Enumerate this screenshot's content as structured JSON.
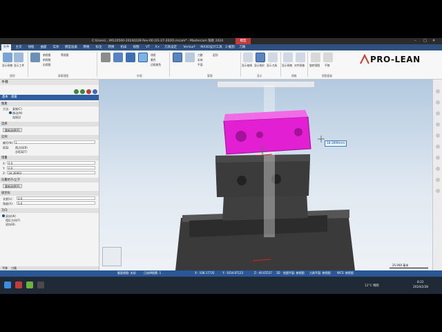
{
  "window": {
    "title": "C:\\Users\\...\\M120500-20240228 Rev-00 (01-27-2020).mcam* - Mastercam 铣削 2024",
    "context_tab": "模型"
  },
  "logo": {
    "text": "PRO-LEAN"
  },
  "ribbon_tabs": [
    "文件",
    "主页",
    "线框",
    "曲面",
    "实体",
    "模型准备",
    "网格",
    "标注",
    "转换",
    "机床",
    "视图",
    "VT",
    "X+",
    "刀具设定",
    "Verisurf",
    "MX3D设计工具",
    "2-截割",
    "刀路"
  ],
  "active_tab_index": 0,
  "ribbon_groups": [
    {
      "label": "规划",
      "buttons": [
        "显示网格",
        "显示工件"
      ]
    },
    {
      "label": "屏幕视图",
      "buttons": [
        "俯视图",
        "前视图",
        "右视图",
        "等视图"
      ]
    },
    {
      "label": "外观",
      "buttons": [
        "线框",
        "着色",
        "边框着色"
      ]
    },
    {
      "label": "管理",
      "buttons": [
        "刀路",
        "实体",
        "平面",
        "层别"
      ]
    },
    {
      "label": "显示",
      "buttons": [
        "显示轴线",
        "显示指针",
        "显示刀具"
      ]
    },
    {
      "label": "网格",
      "buttons": [
        "显示网格",
        "对齐网格"
      ]
    },
    {
      "label": "视图面板",
      "buttons": [
        "旋转视图",
        "平移"
      ]
    }
  ],
  "panel": {
    "title": "平移",
    "subtabs": [
      "基本",
      "高级"
    ],
    "sections": {
      "method_title": "图素",
      "method_options": [
        "复制(C)",
        "移动(M)",
        "连接(J)"
      ],
      "method_selected": 1,
      "select": "选择",
      "reselect_label": "重新选择(R)",
      "instances_title": "实例",
      "count_label": "编号(N):",
      "count_value": "1",
      "distance_label": "距离:",
      "distance_options": [
        "两点间(B)",
        "总距离(T)"
      ],
      "delta_title": "增量",
      "x_label": "X:",
      "x_value": "0.0",
      "y_label": "Y:",
      "y_value": "0.0",
      "z_label": "Z:",
      "z_value": "18.36993",
      "vector_title": "向量始于/止于",
      "reselect2_label": "重新选择(R)",
      "polar_title": "极坐标",
      "length_label": "长度(L):",
      "length_value": "0.0",
      "angle_label": "角度(A):",
      "angle_value": "0.0",
      "direction_title": "方向",
      "direction_options": [
        "双向(W)",
        "相反方向(F)",
        "双向(B)"
      ],
      "direction_selected": 0
    },
    "bottom_tabs": [
      "平移",
      "刀路"
    ]
  },
  "viewport": {
    "dimension_label": "18.3699mm",
    "scale_label": "25.000 毫米",
    "scale_unit": "Metric"
  },
  "statusbar": {
    "section_view": "截面视图: 关闭",
    "selected": "已选择图素: 1",
    "x": "X: -108.17735",
    "y": "Y: -1034.87123",
    "z": "Z: -40.65537",
    "mode": "3D",
    "plane": "绘图平面: 俯视图",
    "tool_plane": "刀具平面: 俯视图",
    "wcs": "WCS: 俯视图"
  },
  "taskbar": {
    "weather": "12°C 晴朗",
    "time": "8:22",
    "date": "2024/2/28"
  },
  "colors": {
    "tab_bar": "#2f4f7f",
    "status_bar": "#2b5797",
    "part_magenta": "#e21fd2",
    "vise_gray": "#3b3b3b"
  }
}
